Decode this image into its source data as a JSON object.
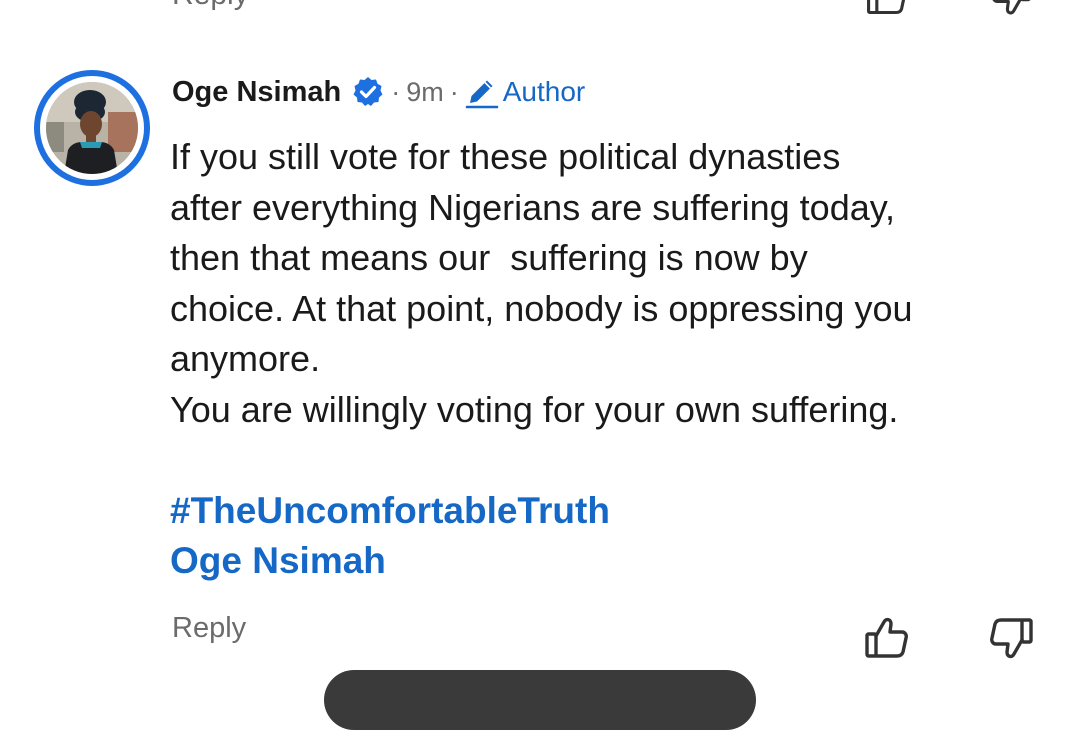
{
  "previous_comment": {
    "reply_label": "Reply"
  },
  "comment": {
    "author_name": "Oge Nsimah",
    "verified": true,
    "separator": "·",
    "timestamp": "9m",
    "author_badge": "Author",
    "body": "If you still vote for these political dynasties\nafter everything Nigerians are suffering today,\nthen that means our  suffering is now by\nchoice. At that point, nobody is oppressing you\nanymore.\nYou are willingly voting for your own suffering.",
    "hashtag": "#TheUncomfortableTruth",
    "signature": "Oge Nsimah",
    "reply_label": "Reply"
  },
  "colors": {
    "link_blue": "#1668c6",
    "avatar_ring": "#1e6fe0",
    "muted_text": "#6b6b6b"
  },
  "icons": {
    "verified": "verified-badge-icon",
    "author": "pencil-edit-icon",
    "like": "thumbs-up-icon",
    "dislike": "thumbs-down-icon"
  }
}
